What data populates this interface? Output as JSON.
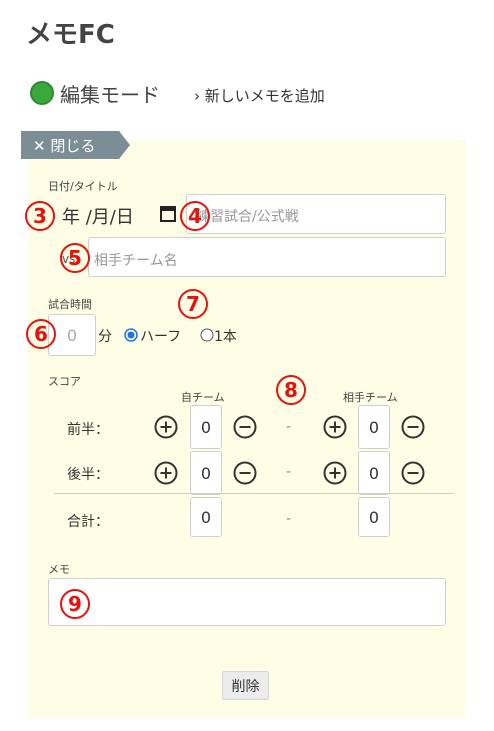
{
  "app": {
    "title": "メモFC"
  },
  "mode": {
    "label": "編集モード",
    "add_link": "› 新しいメモを追加"
  },
  "close_tab": {
    "label": "✕  閉じる"
  },
  "form": {
    "date_title_label": "日付/タイトル",
    "date_text": "年 /月/日",
    "title_placeholder": "練習試合/公式戦",
    "vs_label": "vs",
    "opponent_placeholder": "相手チーム名",
    "match_time_label": "試合時間",
    "minutes_value": "0",
    "minutes_unit": "分",
    "half_option": "ハーフ",
    "full_option": "1本",
    "score_label": "スコア",
    "own_team": "自チーム",
    "opponent_team": "相手チーム",
    "rows": [
      {
        "label": "前半：",
        "own": "0",
        "opp": "0"
      },
      {
        "label": "後半：",
        "own": "0",
        "opp": "0"
      },
      {
        "label": "合計：",
        "own": "0",
        "opp": "0"
      }
    ],
    "dash": "-",
    "memo_label": "メモ",
    "delete_label": "削除"
  },
  "markers": [
    "3",
    "4",
    "5",
    "6",
    "7",
    "8",
    "9"
  ],
  "colors": {
    "accent_green": "#3aa83a",
    "tab_grey": "#7b8d95",
    "panel_bg": "#fefee6",
    "marker_red": "#e8120c"
  }
}
